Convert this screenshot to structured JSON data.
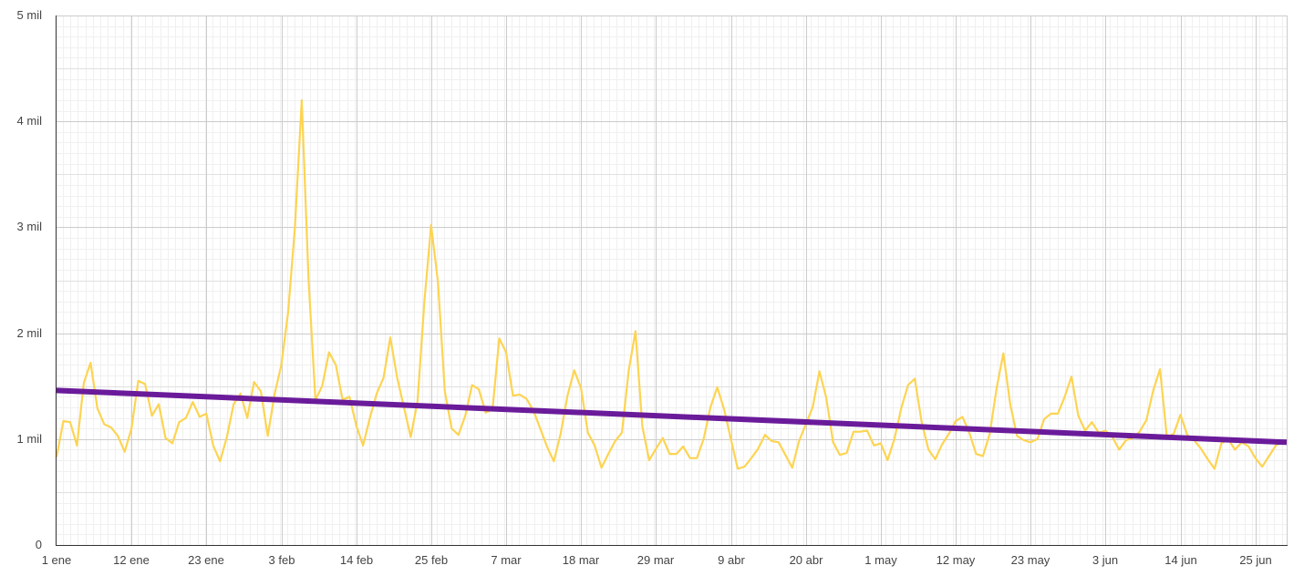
{
  "chart_data": {
    "type": "line",
    "title": "",
    "xlabel": "",
    "ylabel": "",
    "grid": true,
    "ylim": [
      0,
      5000
    ],
    "y_ticks": [
      {
        "value": 0,
        "label": "0"
      },
      {
        "value": 1000,
        "label": "1 mil"
      },
      {
        "value": 2000,
        "label": "2 mil"
      },
      {
        "value": 3000,
        "label": "3 mil"
      },
      {
        "value": 4000,
        "label": "4 mil"
      },
      {
        "value": 5000,
        "label": "5 mil"
      }
    ],
    "x_ticks": [
      "1 ene",
      "12 ene",
      "23 ene",
      "3 feb",
      "14 feb",
      "25 feb",
      "7 mar",
      "18 mar",
      "29 mar",
      "9 abr",
      "20 abr",
      "1 may",
      "12 may",
      "23 may",
      "3 jun",
      "14 jun",
      "25 jun"
    ],
    "series": [
      {
        "color": "#fdd452",
        "style": "data",
        "start": "1 ene",
        "values": [
          830,
          1170,
          1160,
          940,
          1530,
          1720,
          1290,
          1140,
          1110,
          1030,
          880,
          1100,
          1550,
          1520,
          1220,
          1330,
          1010,
          960,
          1160,
          1200,
          1350,
          1210,
          1240,
          940,
          790,
          1020,
          1330,
          1430,
          1200,
          1540,
          1450,
          1030,
          1420,
          1700,
          2200,
          3000,
          4200,
          2500,
          1370,
          1500,
          1820,
          1700,
          1370,
          1400,
          1130,
          940,
          1200,
          1430,
          1580,
          1960,
          1580,
          1300,
          1020,
          1360,
          2300,
          3020,
          2480,
          1450,
          1100,
          1040,
          1220,
          1510,
          1470,
          1250,
          1280,
          1950,
          1820,
          1410,
          1420,
          1380,
          1270,
          1100,
          930,
          790,
          1050,
          1410,
          1650,
          1480,
          1060,
          940,
          730,
          860,
          980,
          1060,
          1650,
          2020,
          1120,
          800,
          910,
          1010,
          860,
          860,
          930,
          820,
          820,
          1000,
          1300,
          1490,
          1280,
          1000,
          720,
          740,
          820,
          910,
          1040,
          980,
          970,
          850,
          730,
          980,
          1140,
          1300,
          1640,
          1390,
          970,
          850,
          870,
          1070,
          1070,
          1080,
          940,
          960,
          800,
          1000,
          1290,
          1510,
          1570,
          1160,
          900,
          810,
          950,
          1050,
          1170,
          1210,
          1060,
          860,
          840,
          1050,
          1480,
          1810,
          1330,
          1030,
          990,
          970,
          1000,
          1190,
          1240,
          1240,
          1400,
          1590,
          1220,
          1080,
          1160,
          1060,
          1080,
          1020,
          900,
          990,
          1010,
          1070,
          1180,
          1460,
          1660,
          1020,
          1050,
          1230,
          1040,
          990,
          910,
          810,
          720,
          960,
          1000,
          900,
          970,
          930,
          820,
          740,
          840,
          940,
          980
        ]
      },
      {
        "color": "#6a1b9a",
        "style": "trendline",
        "start_value": 1460,
        "end_value": 970
      }
    ]
  }
}
